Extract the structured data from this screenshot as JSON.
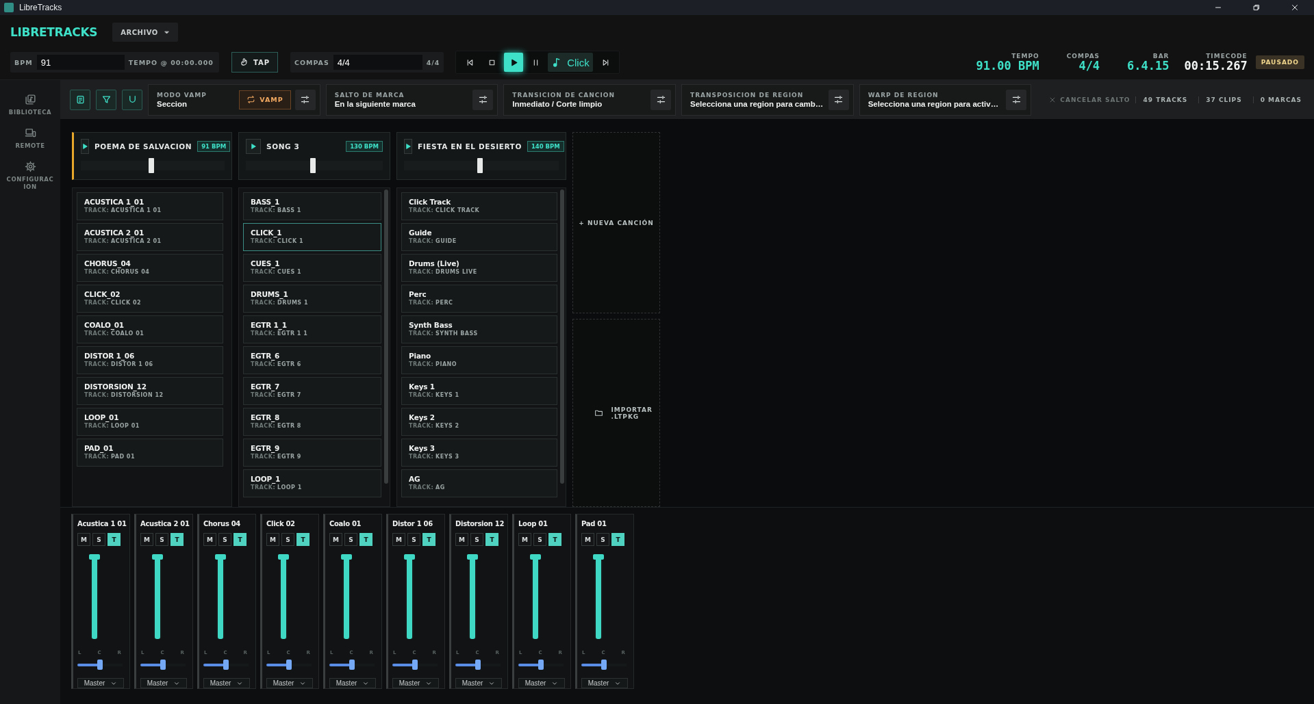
{
  "window": {
    "title": "LibreTracks"
  },
  "header": {
    "logo": "LIBRETRACKS",
    "menu": "ARCHIVO",
    "bpm_label": "BPM",
    "bpm": "91",
    "tempo_at": "TEMPO @ 00:00.000",
    "tap": "TAP",
    "compas_label": "COMPAS",
    "compas": "4/4",
    "compas_suffix": "4/4",
    "transport": [
      {
        "kind": "prev",
        "selected": false
      },
      {
        "kind": "stop",
        "selected": false
      },
      {
        "kind": "play",
        "selected": true
      },
      {
        "kind": "pause",
        "selected": false
      },
      {
        "kind": "click",
        "label": "Click",
        "selected": false
      },
      {
        "kind": "next",
        "selected": false
      }
    ],
    "readouts": [
      {
        "label": "TEMPO",
        "value": "91.00 BPM",
        "accent": true
      },
      {
        "label": "COMPAS",
        "value": "4/4",
        "accent": true
      },
      {
        "label": "BAR",
        "value": "6.4.15",
        "accent": true
      },
      {
        "label": "TIMECODE",
        "value": "00:15.267",
        "accent": false
      }
    ],
    "status": "PAUSADO"
  },
  "sidebar": [
    {
      "kind": "library",
      "label": "BIBLIOTECA"
    },
    {
      "kind": "remote",
      "label": "REMOTE"
    },
    {
      "kind": "settings",
      "label": "CONFIGURACION"
    }
  ],
  "toolbar": {
    "tools": [
      {
        "kind": "notes"
      },
      {
        "kind": "filter"
      },
      {
        "kind": "magnet"
      }
    ],
    "panels": [
      {
        "label": "MODO VAMP",
        "value": "Seccion",
        "action": "VAMP"
      },
      {
        "label": "SALTO DE MARCA",
        "value": "En la siguiente marca"
      },
      {
        "label": "TRANSICION DE CANCION",
        "value": "Inmediato / Corte limpio"
      },
      {
        "label": "TRANSPOSICION DE REGION",
        "value": "Selecciona una region para camb…"
      },
      {
        "label": "WARP DE REGION",
        "value": "Selecciona una region para activ…"
      }
    ],
    "cancel": "CANCELAR SALTO",
    "counts": [
      "49 TRACKS",
      "37 CLIPS",
      "0 MARCAS"
    ]
  },
  "songs": [
    {
      "title": "POEMA DE SALVACION",
      "bpm": "91 BPM",
      "active": true,
      "level": 0.49,
      "scrollbar": false,
      "clips": [
        {
          "name": "ACUSTICA 1_01",
          "prefix": "TRACK:",
          "track": "ACUSTICA 1 01",
          "selected": false
        },
        {
          "name": "ACUSTICA 2_01",
          "prefix": "TRACK:",
          "track": "ACUSTICA 2 01",
          "selected": false
        },
        {
          "name": "CHORUS_04",
          "prefix": "TRACK:",
          "track": "CHORUS 04",
          "selected": false
        },
        {
          "name": "CLICK_02",
          "prefix": "TRACK:",
          "track": "CLICK 02",
          "selected": false
        },
        {
          "name": "COALO_01",
          "prefix": "TRACK:",
          "track": "COALO 01",
          "selected": false
        },
        {
          "name": "DISTOR 1_06",
          "prefix": "TRACK:",
          "track": "DISTOR 1 06",
          "selected": false
        },
        {
          "name": "DISTORSION_12",
          "prefix": "TRACK:",
          "track": "DISTORSION 12",
          "selected": false
        },
        {
          "name": "LOOP_01",
          "prefix": "TRACK:",
          "track": "LOOP 01",
          "selected": false
        },
        {
          "name": "PAD_01",
          "prefix": "TRACK:",
          "track": "PAD 01",
          "selected": false
        }
      ]
    },
    {
      "title": "SONG 3",
      "bpm": "130 BPM",
      "active": false,
      "level": 0.49,
      "scrollbar": true,
      "clips": [
        {
          "name": "BASS_1",
          "prefix": "TRACK:",
          "track": "BASS 1",
          "selected": false
        },
        {
          "name": "CLICK_1",
          "prefix": "TRACK:",
          "track": "CLICK 1",
          "selected": true
        },
        {
          "name": "CUES_1",
          "prefix": "TRACK:",
          "track": "CUES 1",
          "selected": false
        },
        {
          "name": "DRUMS_1",
          "prefix": "TRACK:",
          "track": "DRUMS 1",
          "selected": false
        },
        {
          "name": "EGTR 1_1",
          "prefix": "TRACK:",
          "track": "EGTR 1 1",
          "selected": false
        },
        {
          "name": "EGTR_6",
          "prefix": "TRACK:",
          "track": "EGTR 6",
          "selected": false
        },
        {
          "name": "EGTR_7",
          "prefix": "TRACK:",
          "track": "EGTR 7",
          "selected": false
        },
        {
          "name": "EGTR_8",
          "prefix": "TRACK:",
          "track": "EGTR 8",
          "selected": false
        },
        {
          "name": "EGTR_9",
          "prefix": "TRACK:",
          "track": "EGTR 9",
          "selected": false
        },
        {
          "name": "LOOP_1",
          "prefix": "TRACK:",
          "track": "LOOP 1",
          "selected": false
        }
      ]
    },
    {
      "title": "FIESTA EN EL DESIERTO",
      "bpm": "140 BPM",
      "active": false,
      "level": 0.49,
      "scrollbar": true,
      "clips": [
        {
          "name": "Click Track",
          "prefix": "TRACK:",
          "track": "CLICK TRACK",
          "selected": false
        },
        {
          "name": "Guide",
          "prefix": "TRACK:",
          "track": "GUIDE",
          "selected": false
        },
        {
          "name": "Drums (Live)",
          "prefix": "TRACK:",
          "track": "DRUMS LIVE",
          "selected": false
        },
        {
          "name": "Perc",
          "prefix": "TRACK:",
          "track": "PERC",
          "selected": false
        },
        {
          "name": "Synth Bass",
          "prefix": "TRACK:",
          "track": "SYNTH BASS",
          "selected": false
        },
        {
          "name": "Piano",
          "prefix": "TRACK:",
          "track": "PIANO",
          "selected": false
        },
        {
          "name": "Keys 1",
          "prefix": "TRACK:",
          "track": "KEYS 1",
          "selected": false
        },
        {
          "name": "Keys 2",
          "prefix": "TRACK:",
          "track": "KEYS 2",
          "selected": false
        },
        {
          "name": "Keys 3",
          "prefix": "TRACK:",
          "track": "KEYS 3",
          "selected": false
        },
        {
          "name": "AG",
          "prefix": "TRACK:",
          "track": "AG",
          "selected": false
        }
      ]
    }
  ],
  "actions": {
    "new_song": "+ NUEVA CANCIÓN",
    "import": "IMPORTAR .LTPKG"
  },
  "mixer": [
    {
      "name": "Acustica 1 01",
      "buttons": [
        {
          "label": "M",
          "on": false
        },
        {
          "label": "S",
          "on": false
        },
        {
          "label": "T",
          "on": true
        }
      ],
      "level": 1,
      "pan_labels": [
        "L",
        "C",
        "R"
      ],
      "pan": {
        "level": 0.5
      },
      "output": "Master"
    },
    {
      "name": "Acustica 2 01",
      "buttons": [
        {
          "label": "M",
          "on": false
        },
        {
          "label": "S",
          "on": false
        },
        {
          "label": "T",
          "on": true
        }
      ],
      "level": 1,
      "pan_labels": [
        "L",
        "C",
        "R"
      ],
      "pan": {
        "level": 0.5
      },
      "output": "Master"
    },
    {
      "name": "Chorus 04",
      "buttons": [
        {
          "label": "M",
          "on": false
        },
        {
          "label": "S",
          "on": false
        },
        {
          "label": "T",
          "on": true
        }
      ],
      "level": 1,
      "pan_labels": [
        "L",
        "C",
        "R"
      ],
      "pan": {
        "level": 0.5
      },
      "output": "Master"
    },
    {
      "name": "Click 02",
      "buttons": [
        {
          "label": "M",
          "on": false
        },
        {
          "label": "S",
          "on": false
        },
        {
          "label": "T",
          "on": true
        }
      ],
      "level": 1,
      "pan_labels": [
        "L",
        "C",
        "R"
      ],
      "pan": {
        "level": 0.5
      },
      "output": "Master"
    },
    {
      "name": "Coalo 01",
      "buttons": [
        {
          "label": "M",
          "on": false
        },
        {
          "label": "S",
          "on": false
        },
        {
          "label": "T",
          "on": true
        }
      ],
      "level": 1,
      "pan_labels": [
        "L",
        "C",
        "R"
      ],
      "pan": {
        "level": 0.5
      },
      "output": "Master"
    },
    {
      "name": "Distor 1 06",
      "buttons": [
        {
          "label": "M",
          "on": false
        },
        {
          "label": "S",
          "on": false
        },
        {
          "label": "T",
          "on": true
        }
      ],
      "level": 1,
      "pan_labels": [
        "L",
        "C",
        "R"
      ],
      "pan": {
        "level": 0.5
      },
      "output": "Master"
    },
    {
      "name": "Distorsion 12",
      "buttons": [
        {
          "label": "M",
          "on": false
        },
        {
          "label": "S",
          "on": false
        },
        {
          "label": "T",
          "on": true
        }
      ],
      "level": 1,
      "pan_labels": [
        "L",
        "C",
        "R"
      ],
      "pan": {
        "level": 0.5
      },
      "output": "Master"
    },
    {
      "name": "Loop 01",
      "buttons": [
        {
          "label": "M",
          "on": false
        },
        {
          "label": "S",
          "on": false
        },
        {
          "label": "T",
          "on": true
        }
      ],
      "level": 1,
      "pan_labels": [
        "L",
        "C",
        "R"
      ],
      "pan": {
        "level": 0.5
      },
      "output": "Master"
    },
    {
      "name": "Pad 01",
      "buttons": [
        {
          "label": "M",
          "on": false
        },
        {
          "label": "S",
          "on": false
        },
        {
          "label": "T",
          "on": true
        }
      ],
      "level": 1,
      "pan_labels": [
        "L",
        "C",
        "R"
      ],
      "pan": {
        "level": 0.5
      },
      "output": "Master"
    }
  ]
}
